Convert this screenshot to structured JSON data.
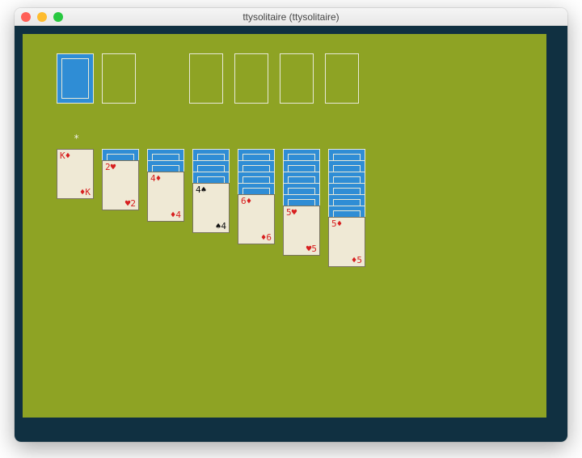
{
  "window": {
    "title": "ttysolitaire (ttysolitaire)"
  },
  "colors": {
    "board": "#8ea324",
    "cardback": "#2f8dd5",
    "cardface": "#efe9d5",
    "term_bg": "#103041"
  },
  "cursor": {
    "glyph": "*"
  },
  "stock": {
    "facedown_count": 1
  },
  "foundations": [
    {},
    {},
    {},
    {}
  ],
  "tableau": [
    {
      "facedown": 0,
      "faceup": {
        "rank": "K",
        "suit": "diamond",
        "color": "red"
      }
    },
    {
      "facedown": 1,
      "faceup": {
        "rank": "2",
        "suit": "heart",
        "color": "red"
      }
    },
    {
      "facedown": 2,
      "faceup": {
        "rank": "4",
        "suit": "diamond",
        "color": "red"
      }
    },
    {
      "facedown": 3,
      "faceup": {
        "rank": "4",
        "suit": "spade",
        "color": "black"
      }
    },
    {
      "facedown": 4,
      "faceup": {
        "rank": "6",
        "suit": "diamond",
        "color": "red"
      }
    },
    {
      "facedown": 5,
      "faceup": {
        "rank": "5",
        "suit": "heart",
        "color": "red"
      }
    },
    {
      "facedown": 6,
      "faceup": {
        "rank": "5",
        "suit": "diamond",
        "color": "red"
      }
    }
  ],
  "suit_glyph": {
    "heart": "♥",
    "diamond": "♦",
    "spade": "♠",
    "club": "♣"
  }
}
